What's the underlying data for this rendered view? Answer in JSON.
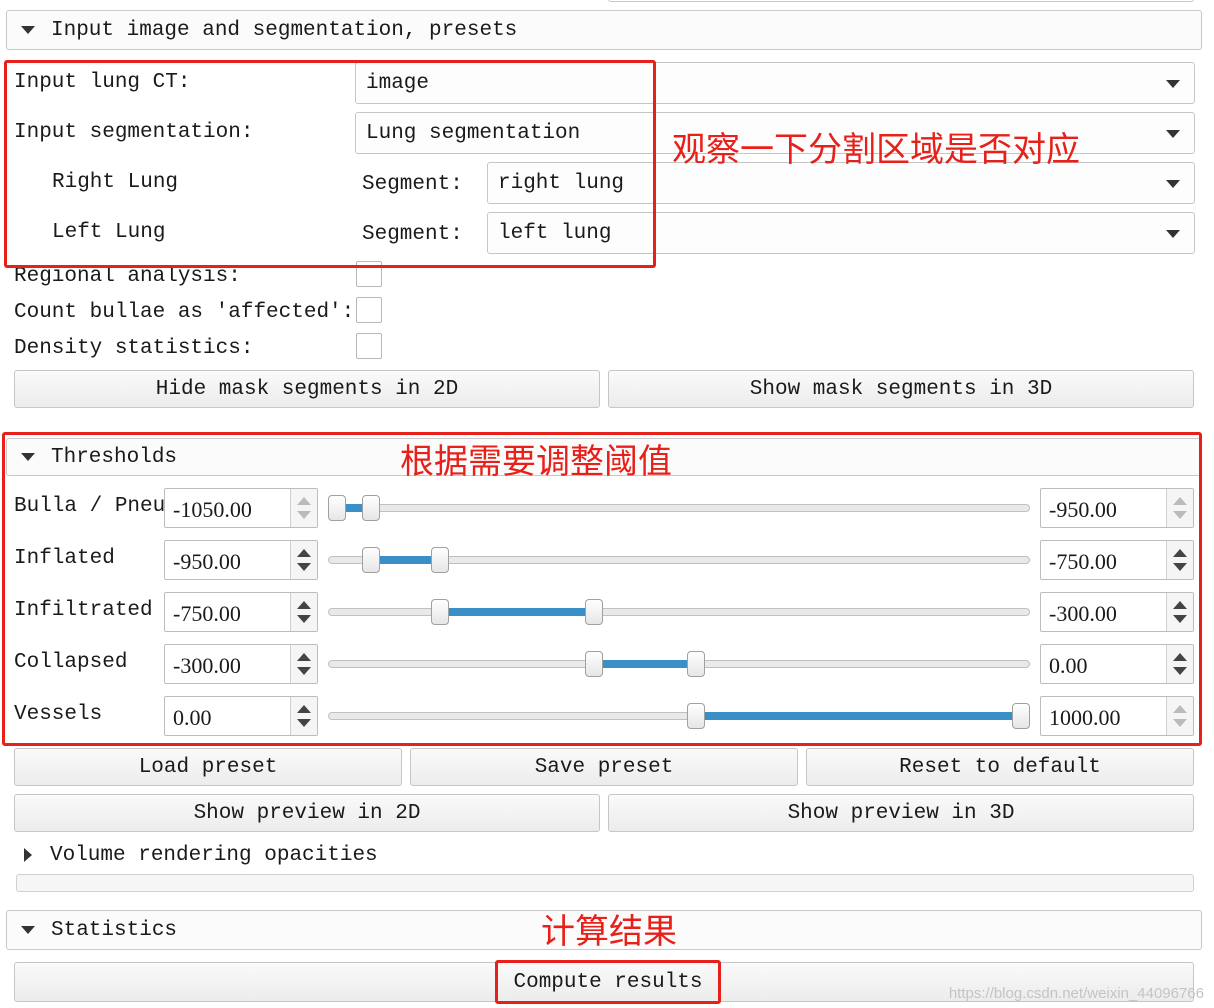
{
  "input_section": {
    "title": "Input image and segmentation, presets",
    "input_ct_label": "Input lung CT:",
    "input_ct_value": "image",
    "input_seg_label": "Input segmentation:",
    "input_seg_value": "Lung segmentation",
    "right_lung_label": "Right Lung",
    "left_lung_label": "Left Lung",
    "segment_label": "Segment:",
    "right_segment_value": "right lung",
    "left_segment_value": "left lung",
    "regional_label": "Regional analysis:",
    "bullae_label": "Count bullae as 'affected':",
    "density_label": "Density statistics:",
    "hide_mask_2d": "Hide mask segments in 2D",
    "show_mask_3d": "Show mask segments in 3D"
  },
  "thresholds": {
    "title": "Thresholds",
    "rows": [
      {
        "label": "Bulla / Pneu",
        "low": "-1050.00",
        "high": "-950.00",
        "low_pos": 0.0,
        "high_pos": 0.05
      },
      {
        "label": "Inflated",
        "low": "-950.00",
        "high": "-750.00",
        "low_pos": 0.05,
        "high_pos": 0.15
      },
      {
        "label": "Infiltrated",
        "low": "-750.00",
        "high": "-300.00",
        "low_pos": 0.15,
        "high_pos": 0.375
      },
      {
        "label": "Collapsed",
        "low": "-300.00",
        "high": "0.00",
        "low_pos": 0.375,
        "high_pos": 0.525
      },
      {
        "label": "Vessels",
        "low": "0.00",
        "high": "1000.00",
        "low_pos": 0.525,
        "high_pos": 1.0
      }
    ],
    "load_preset": "Load preset",
    "save_preset": "Save preset",
    "reset_default": "Reset to default",
    "show_preview_2d": "Show preview in 2D",
    "show_preview_3d": "Show preview in 3D"
  },
  "volume_rendering": {
    "title": "Volume rendering opacities"
  },
  "statistics": {
    "title": "Statistics",
    "compute": "Compute results"
  },
  "annotations": {
    "note_segmentation": "观察一下分割区域是否对应",
    "note_thresholds": "根据需要调整阈值",
    "note_compute": "计算结果"
  },
  "watermark": "https://blog.csdn.net/weixin_44096766",
  "colors": {
    "annotation_red": "#e8201a",
    "slider_blue": "#3a8fc7"
  }
}
